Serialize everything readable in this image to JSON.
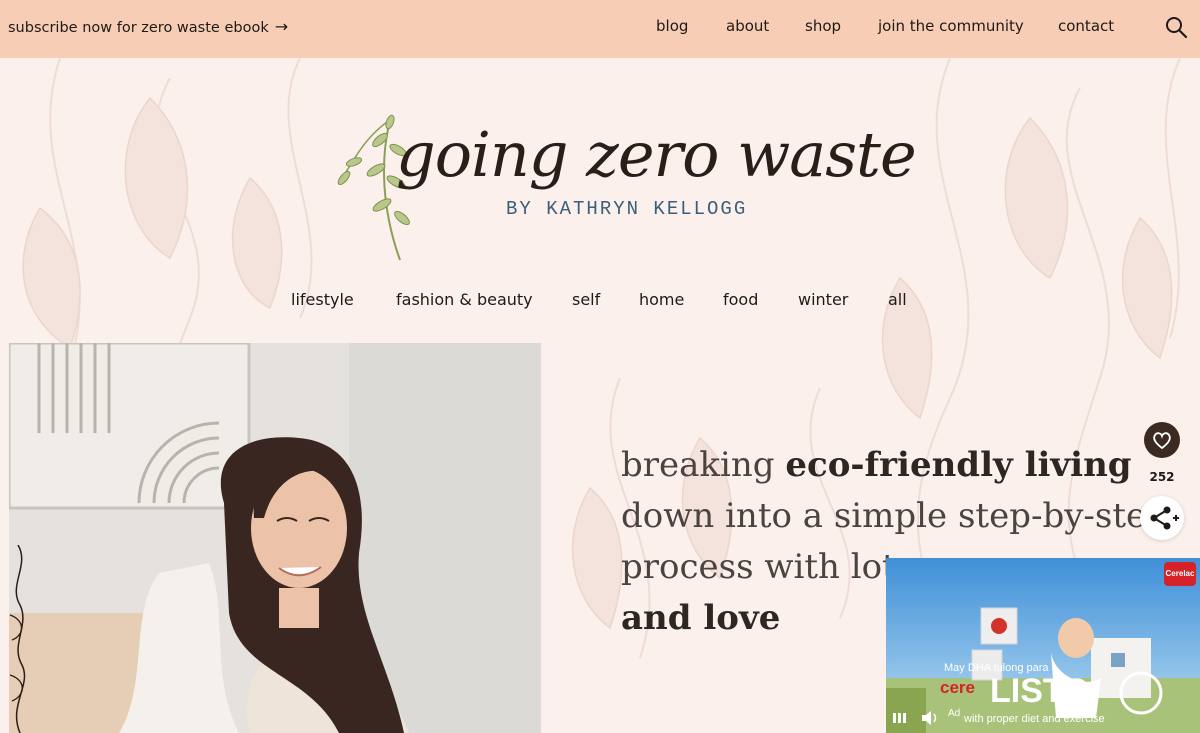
{
  "promo": {
    "text": "subscribe now for zero waste ebook",
    "arrow": "→"
  },
  "top_nav": [
    "blog",
    "about",
    "shop",
    "join the community",
    "contact"
  ],
  "logo": {
    "script_text": "going zero waste",
    "byline": "BY KATHRYN KELLOGG"
  },
  "category_nav": [
    "lifestyle",
    "fashion & beauty",
    "self",
    "home",
    "food",
    "winter",
    "all"
  ],
  "tagline": {
    "part1": "breaking ",
    "part2_bold": "eco-friendly living",
    "part3": " down into a simple step-by-ste",
    "part4": "process with lot",
    "part5_bold": "and love"
  },
  "share": {
    "count": "252"
  },
  "video_ad": {
    "brand": "Cerelac",
    "caption_small": "May DHA tulong para",
    "caption_brand": "cere",
    "caption_big": "LISTO",
    "disclaimer": "with proper diet and exercise",
    "ad_label": "Ad"
  },
  "colors": {
    "topbar": "#f7cdb5",
    "page_bg": "#fbf0ec",
    "byline_blue": "#3b5f7a",
    "heart_button": "#3b2a22"
  },
  "icons": {
    "search": "search-icon",
    "heart": "heart-icon",
    "share": "share-icon"
  }
}
